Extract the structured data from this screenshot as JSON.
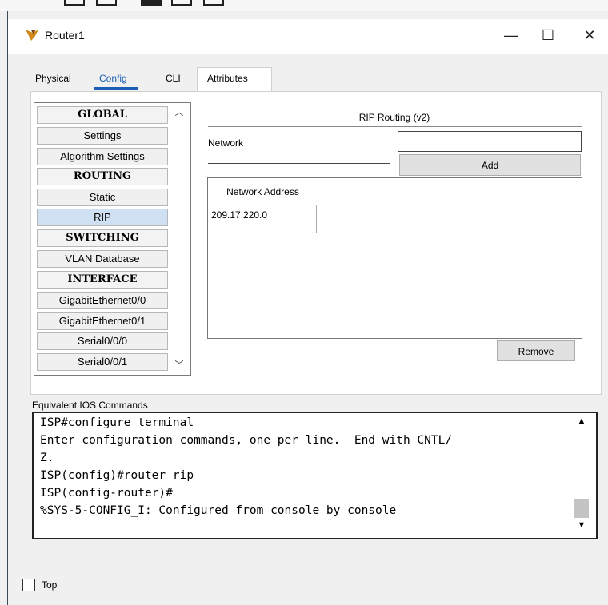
{
  "window": {
    "title": "Router1",
    "minimize": "—",
    "maximize": "☐",
    "close": "✕"
  },
  "tabs": [
    "Physical",
    "Config",
    "CLI",
    "Attributes"
  ],
  "sidebar": {
    "items": [
      {
        "label": "GLOBAL",
        "type": "header"
      },
      {
        "label": "Settings",
        "type": "item"
      },
      {
        "label": "Algorithm Settings",
        "type": "item"
      },
      {
        "label": "ROUTING",
        "type": "header"
      },
      {
        "label": "Static",
        "type": "item"
      },
      {
        "label": "RIP",
        "type": "item",
        "selected": true
      },
      {
        "label": "SWITCHING",
        "type": "header"
      },
      {
        "label": "VLAN Database",
        "type": "item"
      },
      {
        "label": "INTERFACE",
        "type": "header"
      },
      {
        "label": "GigabitEthernet0/0",
        "type": "item"
      },
      {
        "label": "GigabitEthernet0/1",
        "type": "item"
      },
      {
        "label": "Serial0/0/0",
        "type": "item"
      },
      {
        "label": "Serial0/0/1",
        "type": "item"
      }
    ]
  },
  "rip": {
    "title": "RIP Routing (v2)",
    "network_label": "Network",
    "network_value": "",
    "add_label": "Add",
    "table_header": "Network Address",
    "rows": [
      "209.17.220.0"
    ],
    "remove_label": "Remove"
  },
  "ios": {
    "label": "Equivalent IOS Commands",
    "lines": [
      "ISP#configure terminal",
      "Enter configuration commands, one per line.  End with CNTL/",
      "Z.",
      "ISP(config)#router rip",
      "ISP(config-router)#",
      "%SYS-5-CONFIG_I: Configured from console by console"
    ]
  },
  "footer": {
    "top_label": "Top",
    "top_checked": false
  },
  "colors": {
    "accent": "#1a5fb4",
    "selected": "#cfe0f3"
  }
}
